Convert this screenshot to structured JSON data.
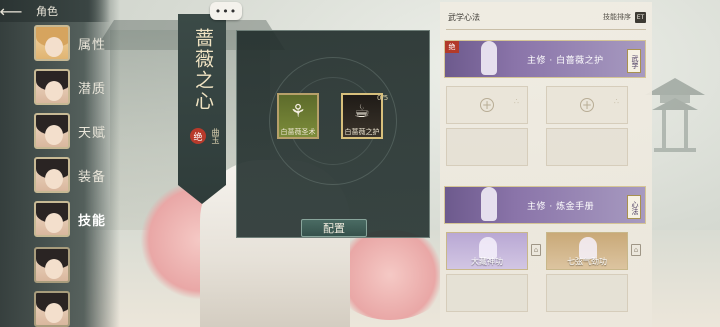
{
  "topbar": {
    "title": "角色"
  },
  "nav": {
    "items": [
      {
        "label": "属性"
      },
      {
        "label": "潜质"
      },
      {
        "label": "天赋"
      },
      {
        "label": "装备"
      },
      {
        "label": "技能",
        "active": true
      }
    ]
  },
  "banner": {
    "title": "蔷薇之心",
    "subtitle": "曲玉",
    "badge": "绝"
  },
  "chat_bubble": "•••",
  "popup": {
    "skills": [
      {
        "label": "白蔷薇圣术"
      },
      {
        "label": "白蔷薇之护",
        "count": "0/5"
      }
    ],
    "config_label": "配置"
  },
  "panel": {
    "title": "武学心法",
    "sort_label": "技能排序",
    "sort_icon": "ET",
    "school1": {
      "tag": "绝",
      "name": "主修 · 白蔷薇之护",
      "type": "武学"
    },
    "school2": {
      "name": "主修 · 炼金手册",
      "type": "心法"
    },
    "skills2": [
      {
        "label": "大藏神功"
      },
      {
        "label": "七弦气劲功"
      }
    ]
  }
}
